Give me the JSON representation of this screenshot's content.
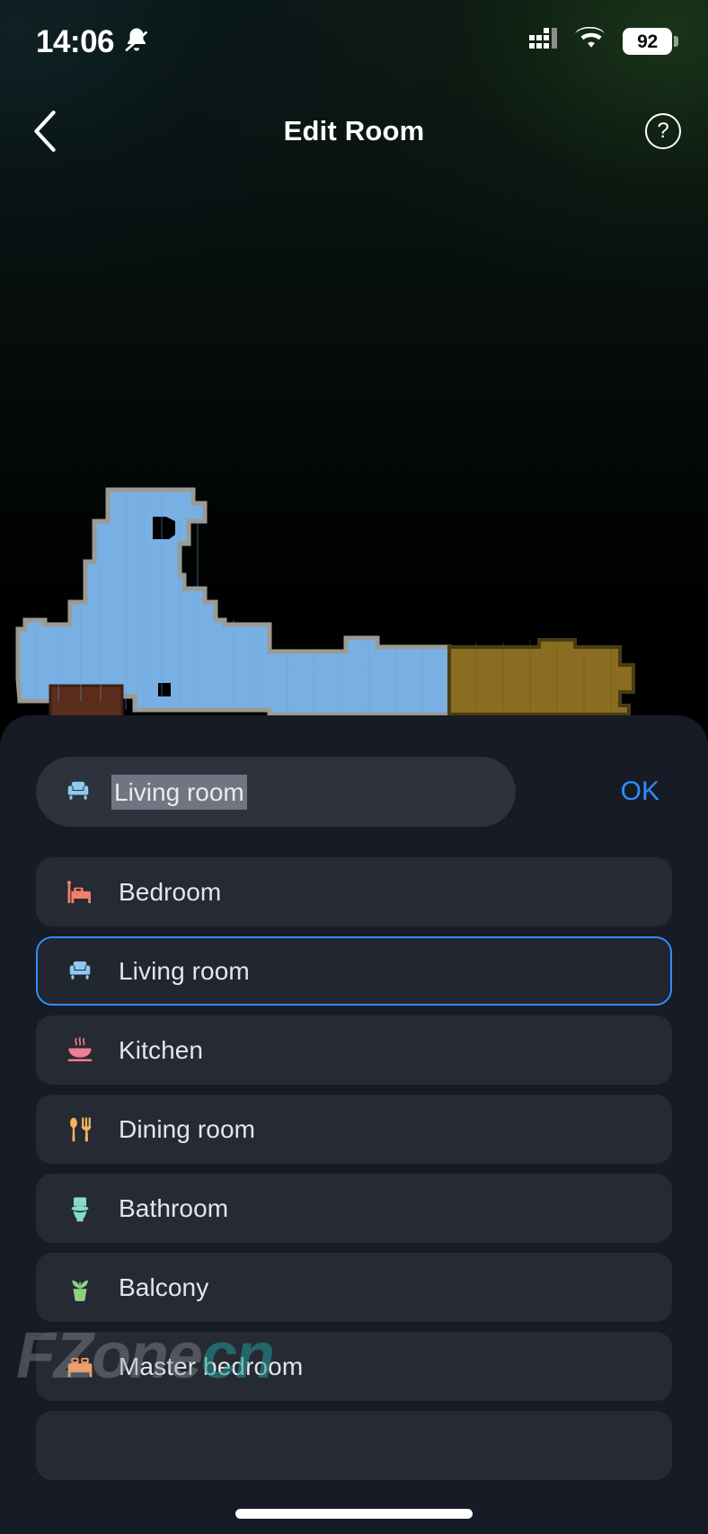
{
  "status_bar": {
    "time": "14:06",
    "bell_icon": "bell-muted-icon",
    "signal_icon": "cellular-signal-icon",
    "wifi_icon": "wifi-icon",
    "battery_level": "92"
  },
  "header": {
    "back_icon": "chevron-left-icon",
    "title": "Edit Room",
    "help_icon": "help-circle-icon",
    "help_glyph": "?"
  },
  "map": {
    "name": "floor-plan-map",
    "room_color_primary": "#79B0E3",
    "room_color_secondary": "#8a6d20",
    "room_color_tertiary": "#5a2d1c",
    "wall_color": "#9b9b93",
    "background": "#000000"
  },
  "sheet": {
    "input": {
      "icon": "sofa-icon",
      "value": "Living room",
      "selected": true
    },
    "ok_label": "OK",
    "accent_color": "#2f8efb",
    "rooms": [
      {
        "label": "Bedroom",
        "icon": "bed-icon",
        "color": "#ef7f6e",
        "selected": false
      },
      {
        "label": "Living room",
        "icon": "sofa-icon",
        "color": "#8ecaf0",
        "selected": true
      },
      {
        "label": "Kitchen",
        "icon": "bowl-icon",
        "color": "#ef7d95",
        "selected": false
      },
      {
        "label": "Dining room",
        "icon": "cutlery-icon",
        "color": "#f2b45c",
        "selected": false
      },
      {
        "label": "Bathroom",
        "icon": "toilet-icon",
        "color": "#84ddc4",
        "selected": false
      },
      {
        "label": "Balcony",
        "icon": "plant-icon",
        "color": "#8ed183",
        "selected": false
      },
      {
        "label": "Master bedroom",
        "icon": "bed-icon",
        "color": "#f0a06a",
        "selected": false
      }
    ]
  },
  "watermark": {
    "part1": "FZone",
    "part2": "cn"
  }
}
